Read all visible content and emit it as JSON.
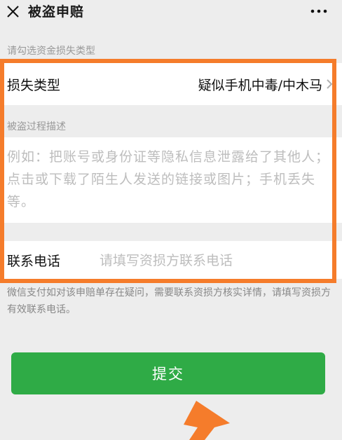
{
  "header": {
    "title": "被盗申赔",
    "close_icon": "close-icon",
    "more_icon": "more-icon"
  },
  "form": {
    "loss_hint": "请勾选资金损失类型",
    "loss_type": {
      "label": "损失类型",
      "value": "疑似手机中毒/中木马"
    },
    "process_hint": "被盗过程描述",
    "process_placeholder": "例如：把账号或身份证等隐私信息泄露给了其他人；点击或下载了陌生人发送的链接或图片；手机丢失等。",
    "contact": {
      "label": "联系电话",
      "placeholder": "请填写资损方联系电话",
      "value": ""
    },
    "footnote": "微信支付如对该申赔单存在疑问，需要联系资损方核实详情，请填写资损方有效联系电话。"
  },
  "actions": {
    "submit_label": "提交"
  },
  "colors": {
    "accent": "#2fab46",
    "highlight": "#f57c2b",
    "background": "#ededed"
  }
}
